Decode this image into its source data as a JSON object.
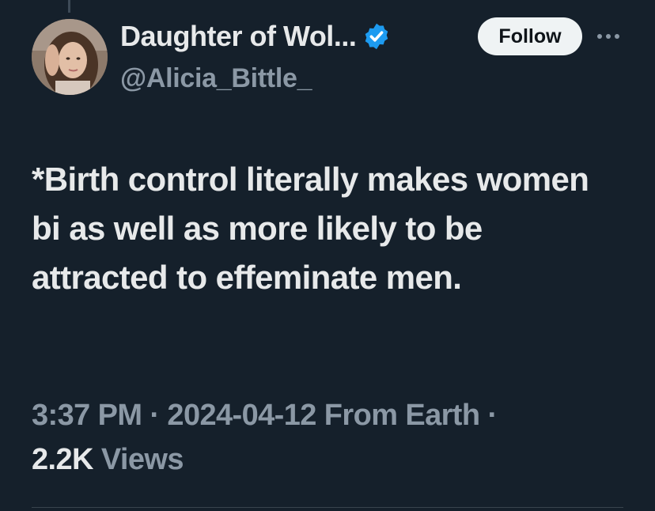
{
  "colors": {
    "background": "#15202b",
    "primary_text": "#e7e9ea",
    "secondary_text": "#8b98a5",
    "verified_badge": "#1d9bf0",
    "follow_button_bg": "#eff3f4"
  },
  "author": {
    "display_name": "Daughter of Wol...",
    "handle": "@Alicia_Bittle_",
    "verified_icon": "verified-badge-icon"
  },
  "actions": {
    "follow_label": "Follow",
    "more_icon": "more-options-icon"
  },
  "tweet": {
    "text": "*Birth control literally makes women bi as well as more likely to be attracted to effeminate men."
  },
  "meta": {
    "time": "3:37 PM",
    "separator": "·",
    "date": "2024-04-12",
    "source": "From Earth",
    "trailing_separator": "·",
    "views_count": "2.2K",
    "views_label": "Views"
  }
}
